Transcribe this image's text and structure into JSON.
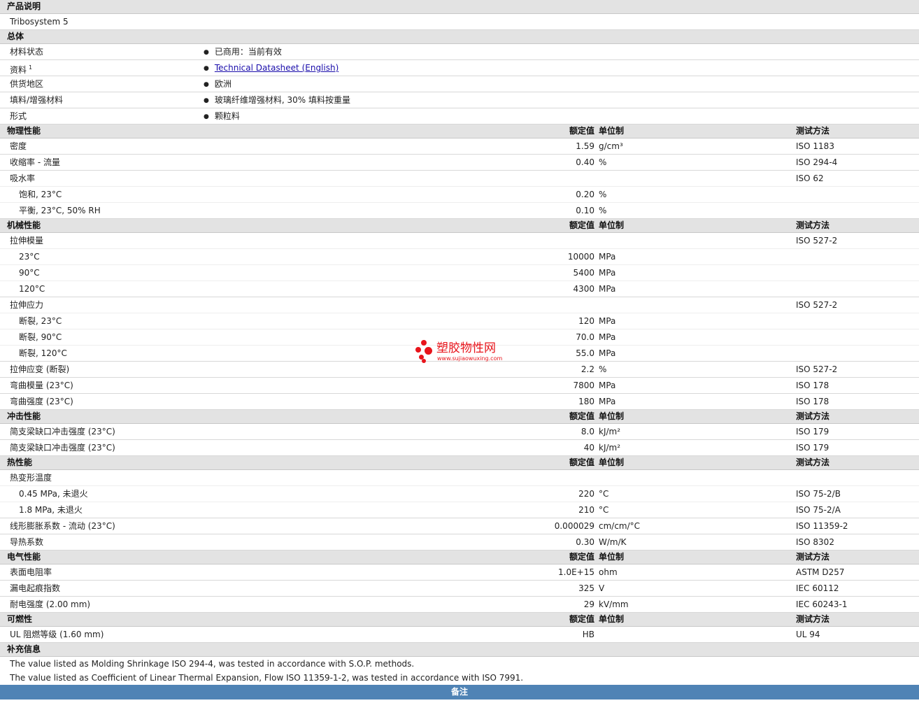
{
  "cols": {
    "value": "额定值",
    "unit": "单位制",
    "test": "测试方法"
  },
  "desc": {
    "title": "产品说明",
    "text": "Tribosystem 5"
  },
  "general": {
    "title": "总体",
    "rows": [
      {
        "label": "材料状态",
        "value": "已商用：当前有效"
      },
      {
        "label": "资料",
        "sup": "1",
        "value": "Technical Datasheet (English)"
      },
      {
        "label": "供货地区",
        "value": "欧洲"
      },
      {
        "label": "填料/增强材料",
        "value": "玻璃纤维增强材料, 30% 填料按重量"
      },
      {
        "label": "形式",
        "value": "颗粒料"
      }
    ]
  },
  "physical": {
    "title": "物理性能",
    "rows": [
      {
        "label": "密度",
        "value": "1.59",
        "unit": "g/cm³",
        "test": "ISO 1183"
      },
      {
        "label": "收缩率 - 流量",
        "value": "0.40",
        "unit": "%",
        "test": "ISO 294-4"
      },
      {
        "label": "吸水率",
        "value": "",
        "unit": "",
        "test": "ISO 62"
      },
      {
        "label": "饱和, 23°C",
        "value": "0.20",
        "unit": "%",
        "test": ""
      },
      {
        "label": "平衡, 23°C, 50% RH",
        "value": "0.10",
        "unit": "%",
        "test": ""
      }
    ]
  },
  "mechanical": {
    "title": "机械性能",
    "rows": [
      {
        "label": "拉伸模量",
        "value": "",
        "unit": "",
        "test": "ISO 527-2"
      },
      {
        "label": "23°C",
        "value": "10000",
        "unit": "MPa",
        "test": ""
      },
      {
        "label": "90°C",
        "value": "5400",
        "unit": "MPa",
        "test": ""
      },
      {
        "label": "120°C",
        "value": "4300",
        "unit": "MPa",
        "test": ""
      },
      {
        "label": "拉伸应力",
        "value": "",
        "unit": "",
        "test": "ISO 527-2"
      },
      {
        "label": "断裂, 23°C",
        "value": "120",
        "unit": "MPa",
        "test": ""
      },
      {
        "label": "断裂, 90°C",
        "value": "70.0",
        "unit": "MPa",
        "test": ""
      },
      {
        "label": "断裂, 120°C",
        "value": "55.0",
        "unit": "MPa",
        "test": ""
      },
      {
        "label": "拉伸应变 (断裂)",
        "value": "2.2",
        "unit": "%",
        "test": "ISO 527-2"
      },
      {
        "label": "弯曲模量 (23°C)",
        "value": "7800",
        "unit": "MPa",
        "test": "ISO 178"
      },
      {
        "label": "弯曲强度 (23°C)",
        "value": "180",
        "unit": "MPa",
        "test": "ISO 178"
      }
    ]
  },
  "impact": {
    "title": "冲击性能",
    "rows": [
      {
        "label": "简支梁缺口冲击强度 (23°C)",
        "value": "8.0",
        "unit": "kJ/m²",
        "test": "ISO 179"
      },
      {
        "label": "简支梁缺口冲击强度 (23°C)",
        "value": "40",
        "unit": "kJ/m²",
        "test": "ISO 179"
      }
    ]
  },
  "thermal": {
    "title": "热性能",
    "rows": [
      {
        "label": "热变形温度",
        "value": "",
        "unit": "",
        "test": ""
      },
      {
        "label": "0.45 MPa, 未退火",
        "value": "220",
        "unit": "°C",
        "test": "ISO 75-2/B"
      },
      {
        "label": "1.8 MPa, 未退火",
        "value": "210",
        "unit": "°C",
        "test": "ISO 75-2/A"
      },
      {
        "label": "线形膨胀系数 - 流动 (23°C)",
        "value": "0.000029",
        "unit": "cm/cm/°C",
        "test": "ISO 11359-2"
      },
      {
        "label": "导热系数",
        "value": "0.30",
        "unit": "W/m/K",
        "test": "ISO 8302"
      }
    ]
  },
  "electrical": {
    "title": "电气性能",
    "rows": [
      {
        "label": "表面电阻率",
        "value": "1.0E+15",
        "unit": "ohm",
        "test": "ASTM D257"
      },
      {
        "label": "漏电起痕指数",
        "value": "325",
        "unit": "V",
        "test": "IEC 60112"
      },
      {
        "label": "耐电强度 (2.00 mm)",
        "value": "29",
        "unit": "kV/mm",
        "test": "IEC 60243-1"
      }
    ]
  },
  "flammability": {
    "title": "可燃性",
    "rows": [
      {
        "label": "UL 阻燃等级 (1.60 mm)",
        "value": "HB",
        "unit": "",
        "test": "UL 94"
      }
    ]
  },
  "supplement": {
    "title": "补充信息",
    "notes": [
      "The value listed as Molding Shrinkage ISO 294-4, was tested in accordance with S.O.P. methods.",
      "The value listed as Coefficient of Linear Thermal Expansion, Flow ISO 11359-1-2, was tested in accordance with ISO 7991."
    ]
  },
  "remarks": {
    "title": "备注"
  },
  "watermark": {
    "name": "塑胶物性网",
    "url": "www.sujiaowuxing.com",
    "color": "#e8141b"
  }
}
